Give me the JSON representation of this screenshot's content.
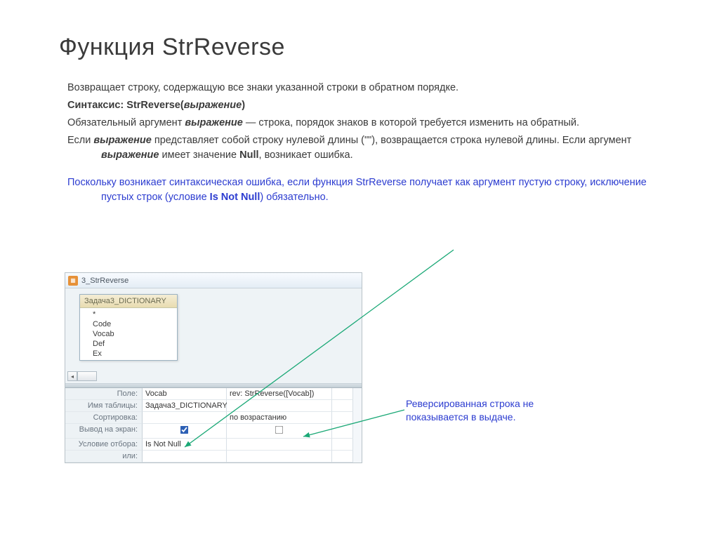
{
  "title": "Функция StrReverse",
  "para1": "Возвращает строку, содержащую все знаки указанной строки в обратном порядке.",
  "syntax_label": "Синтаксис: ",
  "syntax_fn": "StrReverse(",
  "syntax_arg": "выражение",
  "syntax_close": ")",
  "para3_a": "Обязательный аргумент ",
  "para3_b": " — строка, порядок знаков в которой требуется изменить на обратный.",
  "para4_a": "Если ",
  "para4_b": " представляет собой строку нулевой длины (\"\"), возвращается строка нулевой длины. Если аргумент ",
  "para4_c": " имеет значение ",
  "para4_null": "Null",
  "para4_d": ", возникает ошибка.",
  "note_a": "Поскольку возникает синтаксическая ошибка, если функция StrReverse получает как аргумент пустую строку, исключение пустых строк (условие ",
  "note_cond": "Is Not Null",
  "note_b": ") обязательно.",
  "qw": {
    "tab_title": "3_StrReverse",
    "table_name": "Задача3_DICTIONARY",
    "fields": [
      "*",
      "Code",
      "Vocab",
      "Def",
      "Ex"
    ],
    "grid_labels": {
      "field": "Поле:",
      "table": "Имя таблицы:",
      "sort": "Сортировка:",
      "show": "Вывод на экран:",
      "criteria": "Условие отбора:",
      "or": "или:"
    },
    "col1": {
      "field": "Vocab",
      "table": "Задача3_DICTIONARY",
      "sort": "",
      "show_checked": true,
      "criteria": "Is Not Null"
    },
    "col2": {
      "field": "rev: StrReverse([Vocab])",
      "table": "",
      "sort": "по возрастанию",
      "show_checked": false,
      "criteria": ""
    }
  },
  "annotation_text": "Реверсированная строка не показывается в выдаче."
}
